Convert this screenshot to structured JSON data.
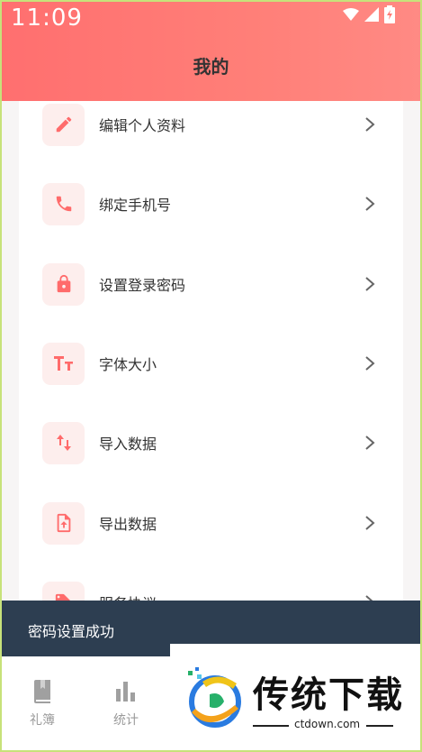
{
  "status_bar": {
    "time": "11:09",
    "icons": [
      "wifi-icon",
      "signal-icon",
      "battery-charging-icon"
    ]
  },
  "header": {
    "title": "我的",
    "background": "#ff7a75"
  },
  "menu": {
    "items": [
      {
        "label": "编辑个人资料",
        "icon": "edit-icon"
      },
      {
        "label": "绑定手机号",
        "icon": "phone-icon"
      },
      {
        "label": "设置登录密码",
        "icon": "lock-icon"
      },
      {
        "label": "字体大小",
        "icon": "font-size-icon"
      },
      {
        "label": "导入数据",
        "icon": "import-icon"
      },
      {
        "label": "导出数据",
        "icon": "export-icon"
      },
      {
        "label": "服务协议",
        "icon": "tag-icon"
      }
    ],
    "accent": "#ff6b6b",
    "icon_bg": "#fdeeed"
  },
  "toast": {
    "text": "密码设置成功"
  },
  "bottom_nav": {
    "items": [
      {
        "label": "礼簿",
        "icon": "book-icon"
      },
      {
        "label": "统计",
        "icon": "bar-chart-icon"
      }
    ]
  },
  "watermark": {
    "title": "传统下载",
    "domain": "ctdown.com"
  }
}
